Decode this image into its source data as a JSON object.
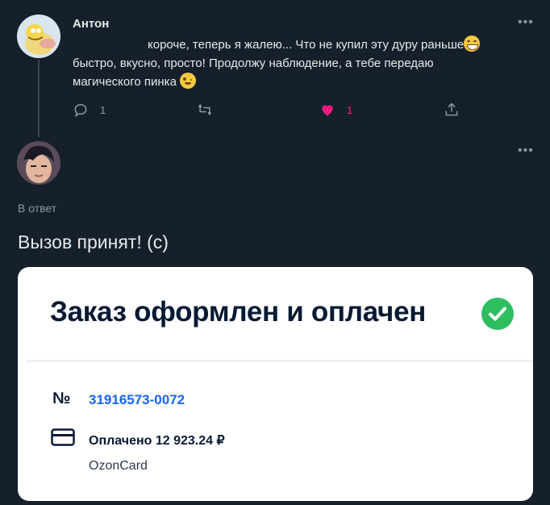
{
  "tweet1": {
    "author": "Антон",
    "text_line1": "короче, теперь я жалею... Что не купил эту дуру раньше",
    "text_line2": "быстро, вкусно, просто! Продолжу наблюдение, а тебе передаю",
    "text_line3": "магического пинка",
    "reply_count": "1",
    "like_count": "1",
    "more": "•••"
  },
  "tweet2": {
    "more": "•••",
    "reply_label": "В ответ",
    "text": "Вызов принят! (с)"
  },
  "order_card": {
    "title": "Заказ оформлен и оплачен",
    "number_sign": "№",
    "order_number": "31916573-0072",
    "paid_text": "Оплачено 12 923.24 ₽",
    "payment_method": "OzonCard"
  },
  "icons": [
    "reply-icon",
    "retweet-icon",
    "heart-icon",
    "share-icon",
    "more-icon",
    "check-icon",
    "card-icon",
    "grin-emoji",
    "wink-emoji"
  ],
  "colors": {
    "background": "#15202b",
    "like": "#f91880",
    "order_link": "#1565ff",
    "check": "#2dbe60"
  }
}
